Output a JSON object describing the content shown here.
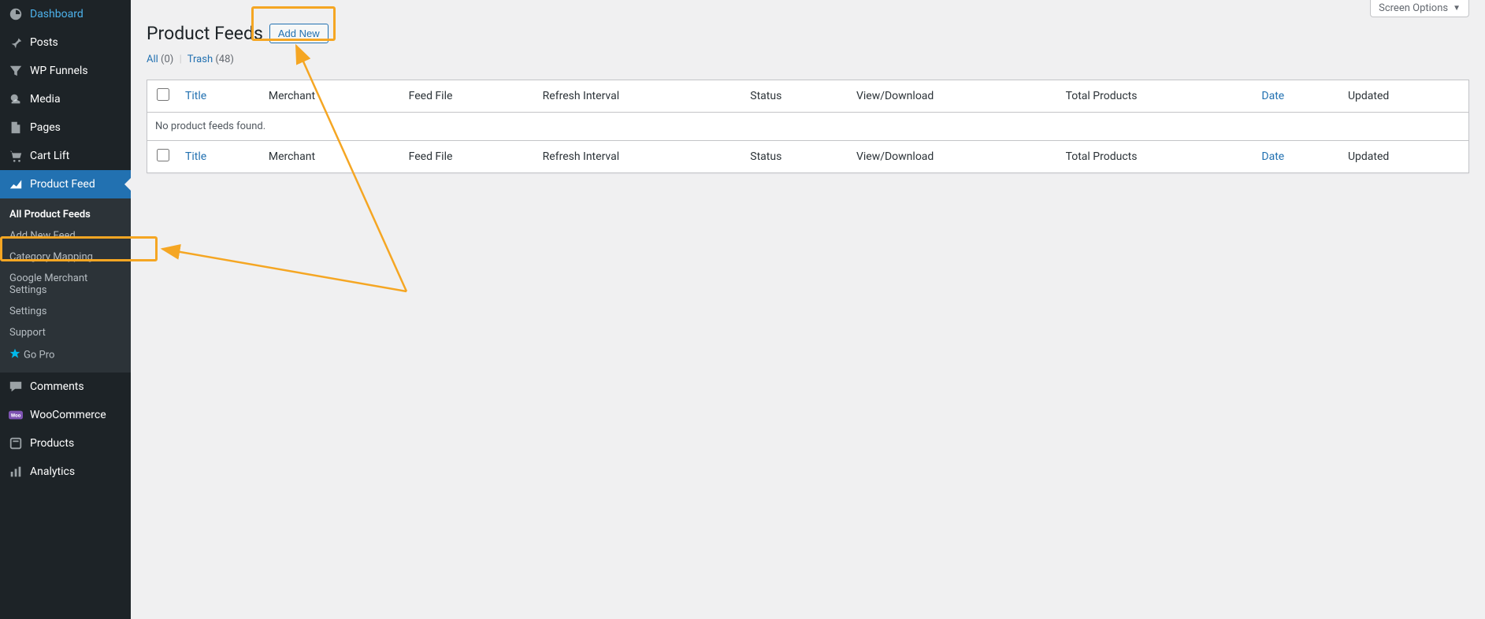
{
  "sidebar": {
    "items": [
      {
        "label": "Dashboard",
        "icon": "dashboard"
      },
      {
        "label": "Posts",
        "icon": "pin"
      },
      {
        "label": "WP Funnels",
        "icon": "funnel"
      },
      {
        "label": "Media",
        "icon": "media"
      },
      {
        "label": "Pages",
        "icon": "page"
      },
      {
        "label": "Cart Lift",
        "icon": "cart"
      },
      {
        "label": "Product Feed",
        "icon": "chart",
        "active": true
      },
      {
        "label": "Comments",
        "icon": "comment"
      },
      {
        "label": "WooCommerce",
        "icon": "woo"
      },
      {
        "label": "Products",
        "icon": "products"
      },
      {
        "label": "Analytics",
        "icon": "analytics"
      }
    ],
    "submenu": [
      {
        "label": "All Product Feeds",
        "current": true
      },
      {
        "label": "Add New Feed"
      },
      {
        "label": "Category Mapping"
      },
      {
        "label": "Google Merchant Settings"
      },
      {
        "label": "Settings"
      },
      {
        "label": "Support"
      },
      {
        "label": "Go Pro",
        "star": true
      }
    ]
  },
  "header": {
    "page_title": "Product Feeds",
    "add_new_label": "Add New",
    "screen_options_label": "Screen Options"
  },
  "filters": {
    "all_label": "All",
    "all_count": "(0)",
    "trash_label": "Trash",
    "trash_count": "(48)"
  },
  "table": {
    "columns": {
      "title": "Title",
      "merchant": "Merchant",
      "feed_file": "Feed File",
      "refresh_interval": "Refresh Interval",
      "status": "Status",
      "view_download": "View/Download",
      "total_products": "Total Products",
      "date": "Date",
      "updated": "Updated"
    },
    "empty_message": "No product feeds found."
  }
}
